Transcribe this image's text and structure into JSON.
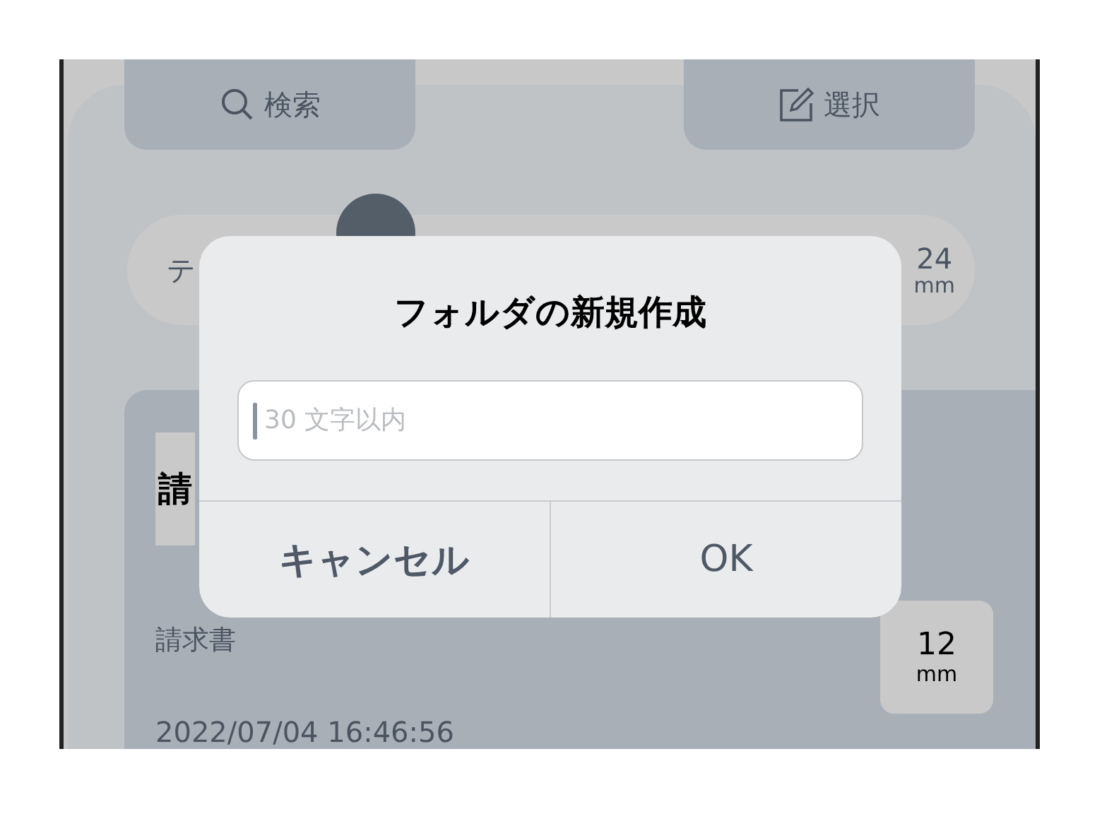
{
  "toolbar": {
    "buttons": [
      {
        "kind": "search",
        "label": "検索"
      },
      {
        "kind": "edit",
        "label": "選択"
      }
    ]
  },
  "tape_bar": {
    "left_text": "テ",
    "right_value": "24",
    "right_unit": "mm"
  },
  "item_card": {
    "preview_text": "請",
    "name": "請求書",
    "timestamp": "2022/07/04 16:46:56",
    "width_value": "12",
    "width_unit": "mm"
  },
  "dialog": {
    "title": "フォルダの新規作成",
    "input": {
      "placeholder": "30 文字以内"
    },
    "buttons": [
      {
        "label": "キャンセル",
        "bold": true
      },
      {
        "label": "OK",
        "bold": false
      }
    ]
  }
}
